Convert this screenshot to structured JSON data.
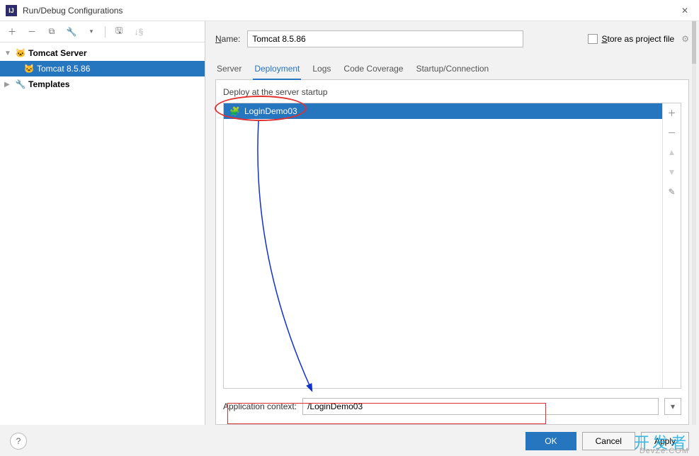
{
  "window": {
    "title": "Run/Debug Configurations"
  },
  "tree": {
    "root1": "Tomcat Server",
    "child1": "Tomcat 8.5.86",
    "root2": "Templates"
  },
  "form": {
    "name_label": "Name:",
    "name_value": "Tomcat 8.5.86",
    "store_label": "Store as project file"
  },
  "tabs": {
    "server": "Server",
    "deployment": "Deployment",
    "logs": "Logs",
    "coverage": "Code Coverage",
    "startup": "Startup/Connection"
  },
  "deploy": {
    "section_label": "Deploy at the server startup",
    "item": "LoginDemo03"
  },
  "context": {
    "label": "Application context:",
    "value": "/LoginDemo03"
  },
  "buttons": {
    "ok": "OK",
    "cancel": "Cancel",
    "apply": "Apply"
  },
  "watermark": "开发者"
}
